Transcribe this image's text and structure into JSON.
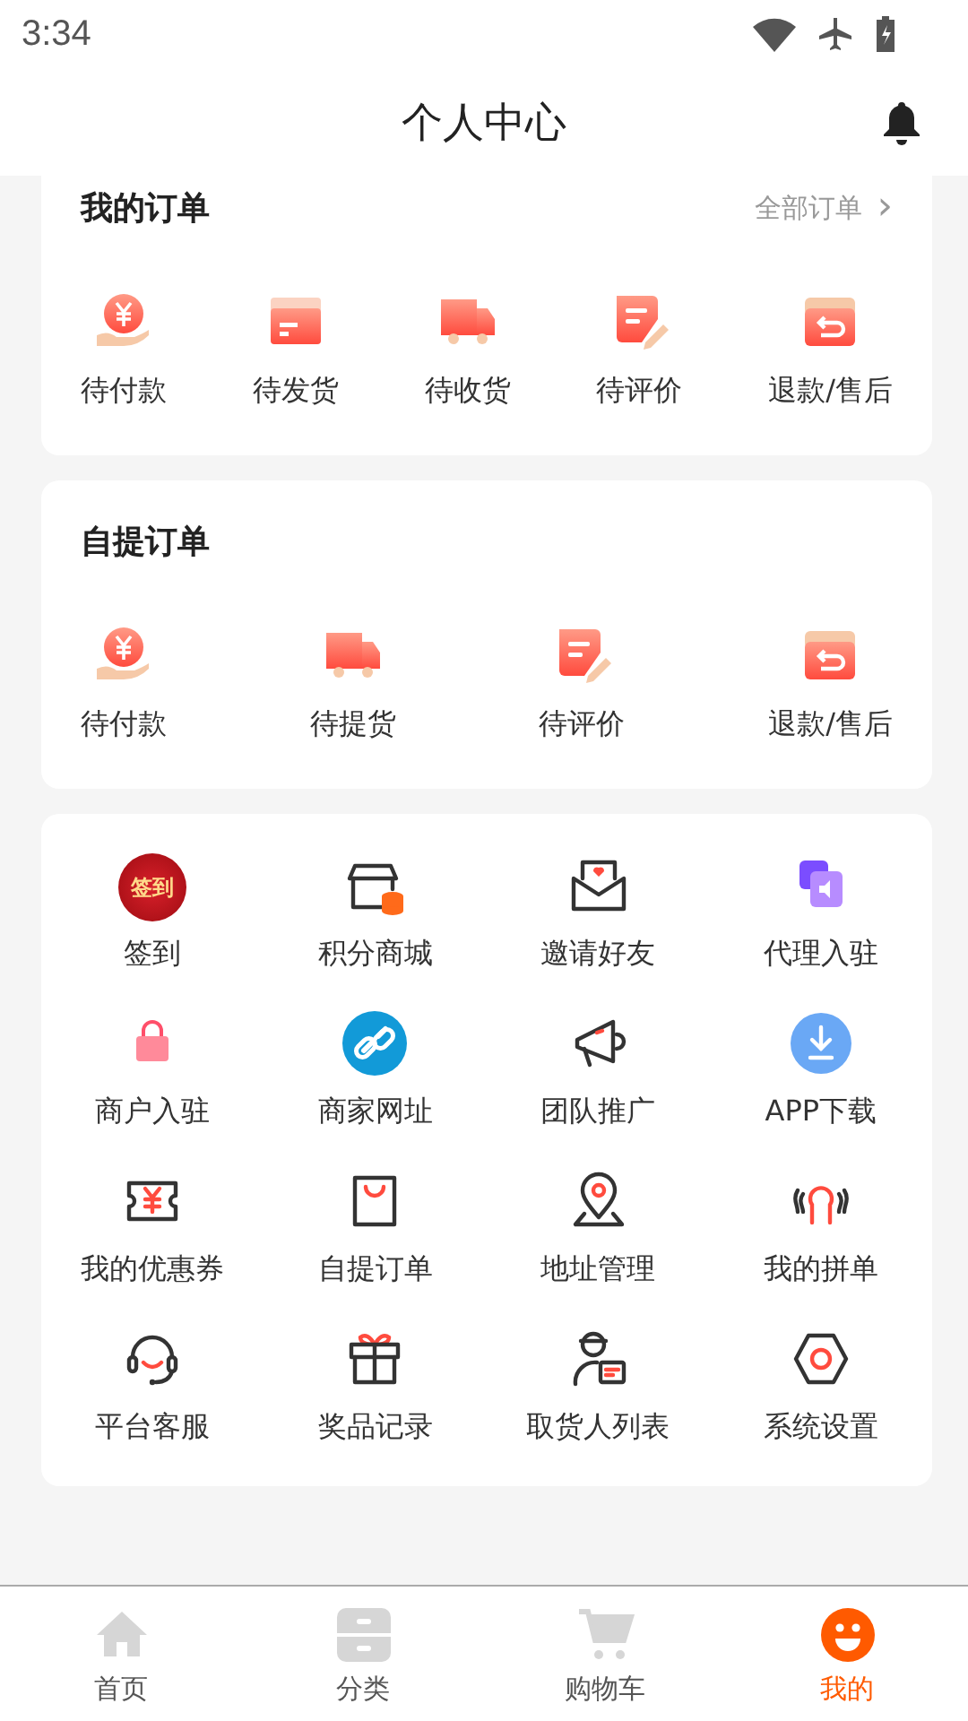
{
  "status_bar": {
    "time": "3:34"
  },
  "header": {
    "title": "个人中心"
  },
  "orders": {
    "title": "我的订单",
    "link": "全部订单",
    "link_arrow": "›",
    "items": [
      {
        "label": "待付款"
      },
      {
        "label": "待发货"
      },
      {
        "label": "待收货"
      },
      {
        "label": "待评价"
      },
      {
        "label": "退款/售后"
      }
    ]
  },
  "pickup_orders": {
    "title": "自提订单",
    "items": [
      {
        "label": "待付款"
      },
      {
        "label": "待提货"
      },
      {
        "label": "待评价"
      },
      {
        "label": "退款/售后"
      }
    ]
  },
  "services": [
    {
      "label": "签到",
      "badge_text": "签到"
    },
    {
      "label": "积分商城"
    },
    {
      "label": "邀请好友"
    },
    {
      "label": "代理入驻"
    },
    {
      "label": "商户入驻"
    },
    {
      "label": "商家网址"
    },
    {
      "label": "团队推广"
    },
    {
      "label": "APP下载"
    },
    {
      "label": "我的优惠券"
    },
    {
      "label": "自提订单"
    },
    {
      "label": "地址管理"
    },
    {
      "label": "我的拼单"
    },
    {
      "label": "平台客服"
    },
    {
      "label": "奖品记录"
    },
    {
      "label": "取货人列表"
    },
    {
      "label": "系统设置"
    }
  ],
  "tab_bar": [
    {
      "label": "首页",
      "selected": false
    },
    {
      "label": "分类",
      "selected": false
    },
    {
      "label": "购物车",
      "selected": false
    },
    {
      "label": "我的",
      "selected": true
    }
  ]
}
